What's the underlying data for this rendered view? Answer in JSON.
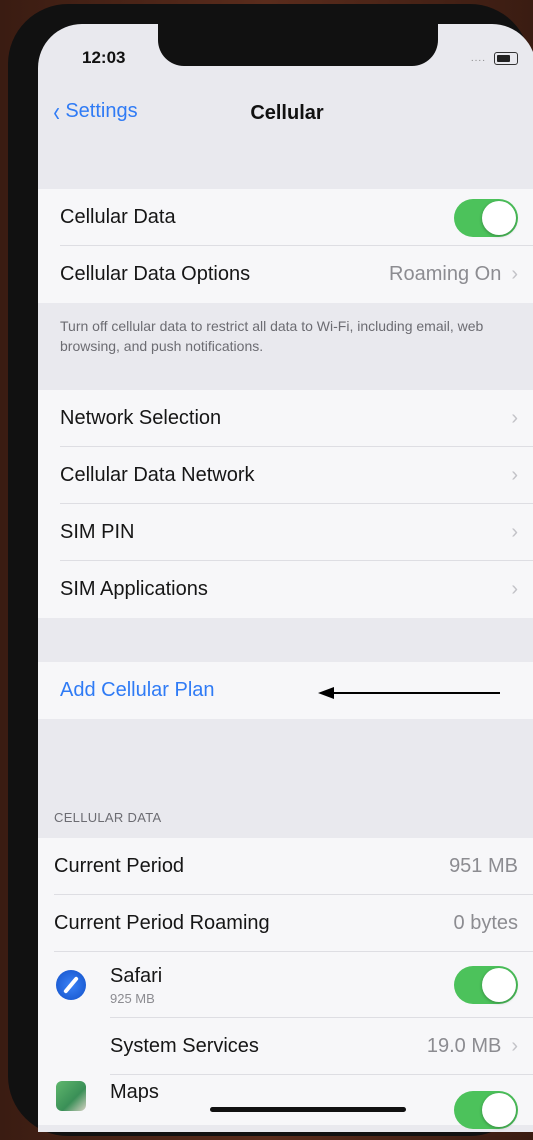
{
  "status": {
    "time": "12:03",
    "signal": "....",
    "battery_level": 0.7
  },
  "nav": {
    "back_label": "Settings",
    "title": "Cellular"
  },
  "group1": {
    "cellular_data_label": "Cellular Data",
    "cellular_data_on": true,
    "options_label": "Cellular Data Options",
    "options_value": "Roaming On",
    "footer": "Turn off cellular data to restrict all data to Wi-Fi, including email, web browsing, and push notifications."
  },
  "group2": {
    "items": [
      {
        "label": "Network Selection"
      },
      {
        "label": "Cellular Data Network"
      },
      {
        "label": "SIM PIN"
      },
      {
        "label": "SIM Applications"
      }
    ]
  },
  "add_plan_label": "Add Cellular Plan",
  "usage": {
    "header": "CELLULAR DATA",
    "current_period_label": "Current Period",
    "current_period_value": "951 MB",
    "roaming_label": "Current Period Roaming",
    "roaming_value": "0 bytes",
    "apps": [
      {
        "name": "Safari",
        "usage": "925 MB",
        "icon": "safari-icon",
        "enabled": true
      },
      {
        "name": "System Services",
        "value": "19.0 MB"
      },
      {
        "name": "Maps",
        "icon": "maps-icon",
        "enabled": true
      }
    ]
  },
  "colors": {
    "accent": "#2f7bf5",
    "toggle_on": "#4cc25b"
  }
}
